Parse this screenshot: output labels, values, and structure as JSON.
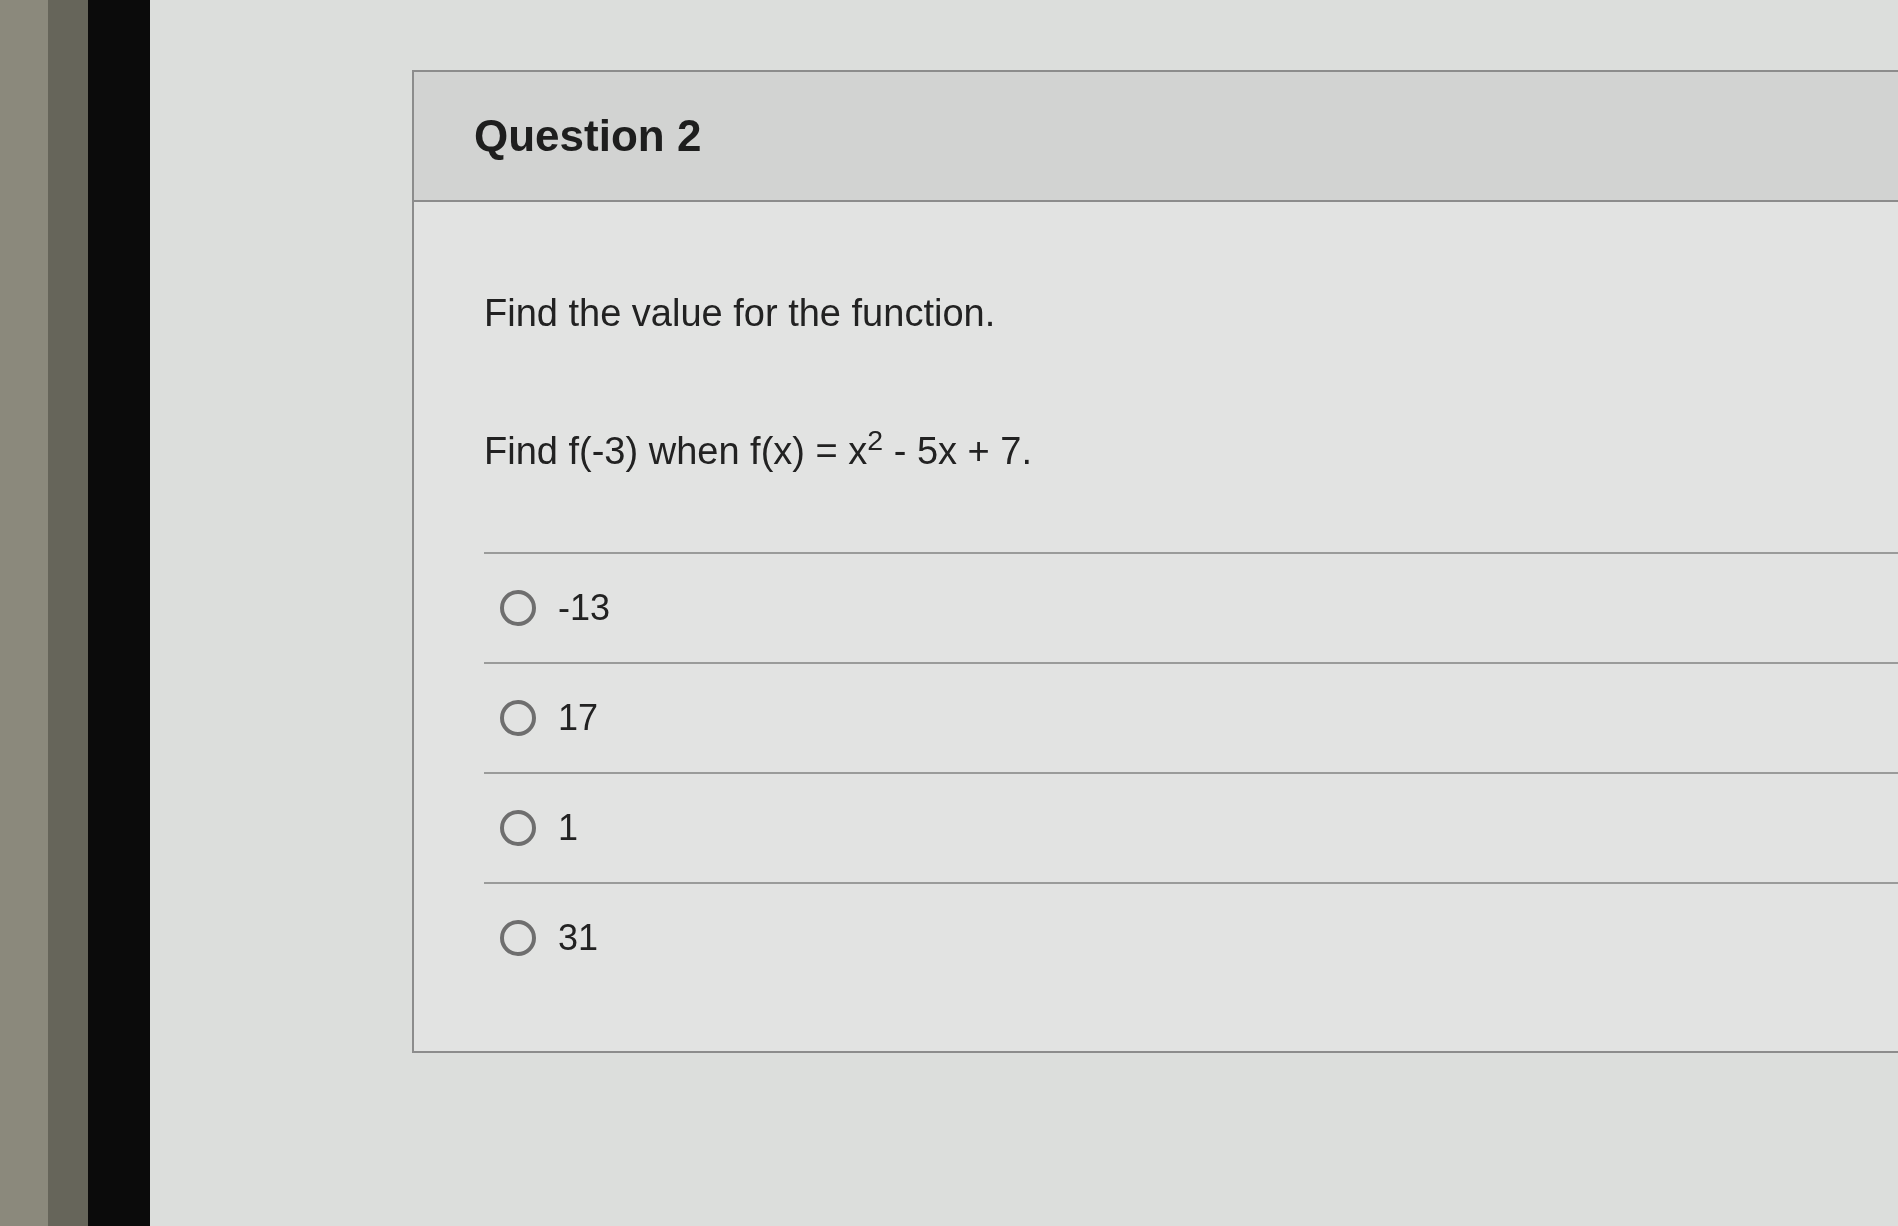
{
  "question": {
    "title": "Question 2",
    "prompt": "Find the value for the function.",
    "equation": "Find f(-3) when f(x) = x$^{2}$ - 5x + 7.",
    "options": [
      {
        "label": "-13",
        "selected": false
      },
      {
        "label": "17",
        "selected": false
      },
      {
        "label": "1",
        "selected": false
      },
      {
        "label": "31",
        "selected": false
      }
    ]
  }
}
